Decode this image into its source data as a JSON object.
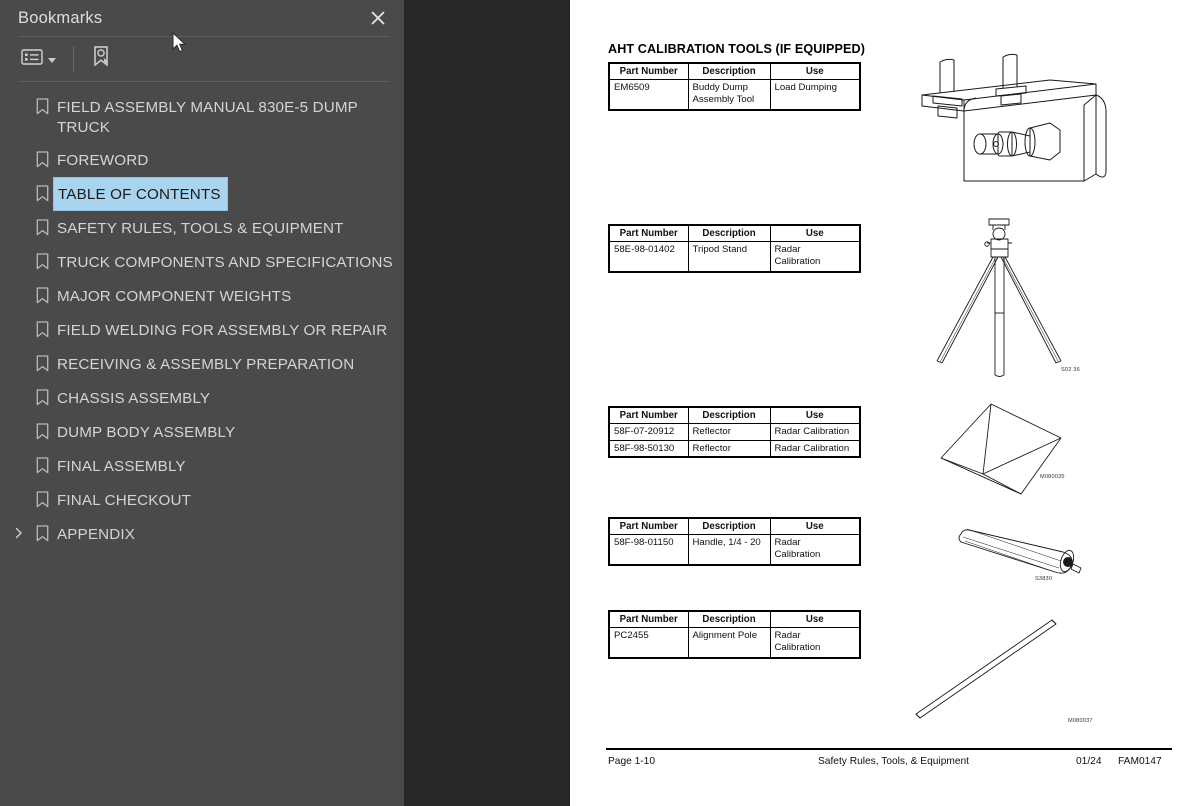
{
  "panel": {
    "title": "Bookmarks",
    "close_icon": "close-icon",
    "toolbar": {
      "options_icon": "list-options-icon",
      "options_caret": "chevron-down-icon",
      "new_bookmark_icon": "new-bookmark-icon"
    },
    "collapse_icon": "collapse-panel-arrow-icon",
    "selected_color": "#a8d4ef",
    "bookmarks": [
      {
        "label": "FIELD ASSEMBLY MANUAL 830E-5  DUMP TRUCK",
        "selected": false,
        "expandable": false
      },
      {
        "label": "FOREWORD",
        "selected": false,
        "expandable": false
      },
      {
        "label": "TABLE OF CONTENTS",
        "selected": true,
        "expandable": false
      },
      {
        "label": "SAFETY RULES, TOOLS & EQUIPMENT",
        "selected": false,
        "expandable": false
      },
      {
        "label": "TRUCK COMPONENTS AND SPECIFICATIONS",
        "selected": false,
        "expandable": false
      },
      {
        "label": "MAJOR COMPONENT WEIGHTS",
        "selected": false,
        "expandable": false
      },
      {
        "label": "FIELD WELDING FOR ASSEMBLY OR REPAIR",
        "selected": false,
        "expandable": false
      },
      {
        "label": "RECEIVING & ASSEMBLY PREPARATION",
        "selected": false,
        "expandable": false
      },
      {
        "label": "CHASSIS ASSEMBLY",
        "selected": false,
        "expandable": false
      },
      {
        "label": "DUMP BODY ASSEMBLY",
        "selected": false,
        "expandable": false
      },
      {
        "label": "FINAL ASSEMBLY",
        "selected": false,
        "expandable": false
      },
      {
        "label": "FINAL CHECKOUT",
        "selected": false,
        "expandable": false
      },
      {
        "label": "APPENDIX",
        "selected": false,
        "expandable": true
      }
    ]
  },
  "document": {
    "heading": "AHT CALIBRATION TOOLS (IF EQUIPPED)",
    "columns": [
      "Part Number",
      "Description",
      "Use"
    ],
    "tables": [
      {
        "id": "buddy-dump-tool",
        "rows": [
          {
            "part_number": "EM6509",
            "description": "Buddy Dump\nAssembly Tool",
            "use": "Load Dumping"
          }
        ]
      },
      {
        "id": "tripod-stand",
        "rows": [
          {
            "part_number": "58E-98-01402",
            "description": "Tripod Stand",
            "use": "Radar\nCalibration"
          }
        ]
      },
      {
        "id": "reflectors",
        "rows": [
          {
            "part_number": "58F-07-20912",
            "description": "Reflector",
            "use": "Radar Calibration"
          },
          {
            "part_number": "58F-98-50130",
            "description": "Reflector",
            "use": "Radar Calibration"
          }
        ]
      },
      {
        "id": "handle",
        "rows": [
          {
            "part_number": "58F-98-01150",
            "description": "Handle, 1/4 - 20",
            "use": "Radar\nCalibration"
          }
        ]
      },
      {
        "id": "alignment-pole",
        "rows": [
          {
            "part_number": "PC2455",
            "description": "Alignment Pole",
            "use": "Radar\nCalibration"
          }
        ]
      }
    ],
    "figure_codes": {
      "tripod": "S02 36",
      "reflector": "M080035",
      "handle": "S3830",
      "pole": "M080037"
    },
    "footer": {
      "page": "Page 1-10",
      "section": "Safety Rules, Tools, & Equipment",
      "date": "01/24",
      "code": "FAM0147"
    }
  }
}
